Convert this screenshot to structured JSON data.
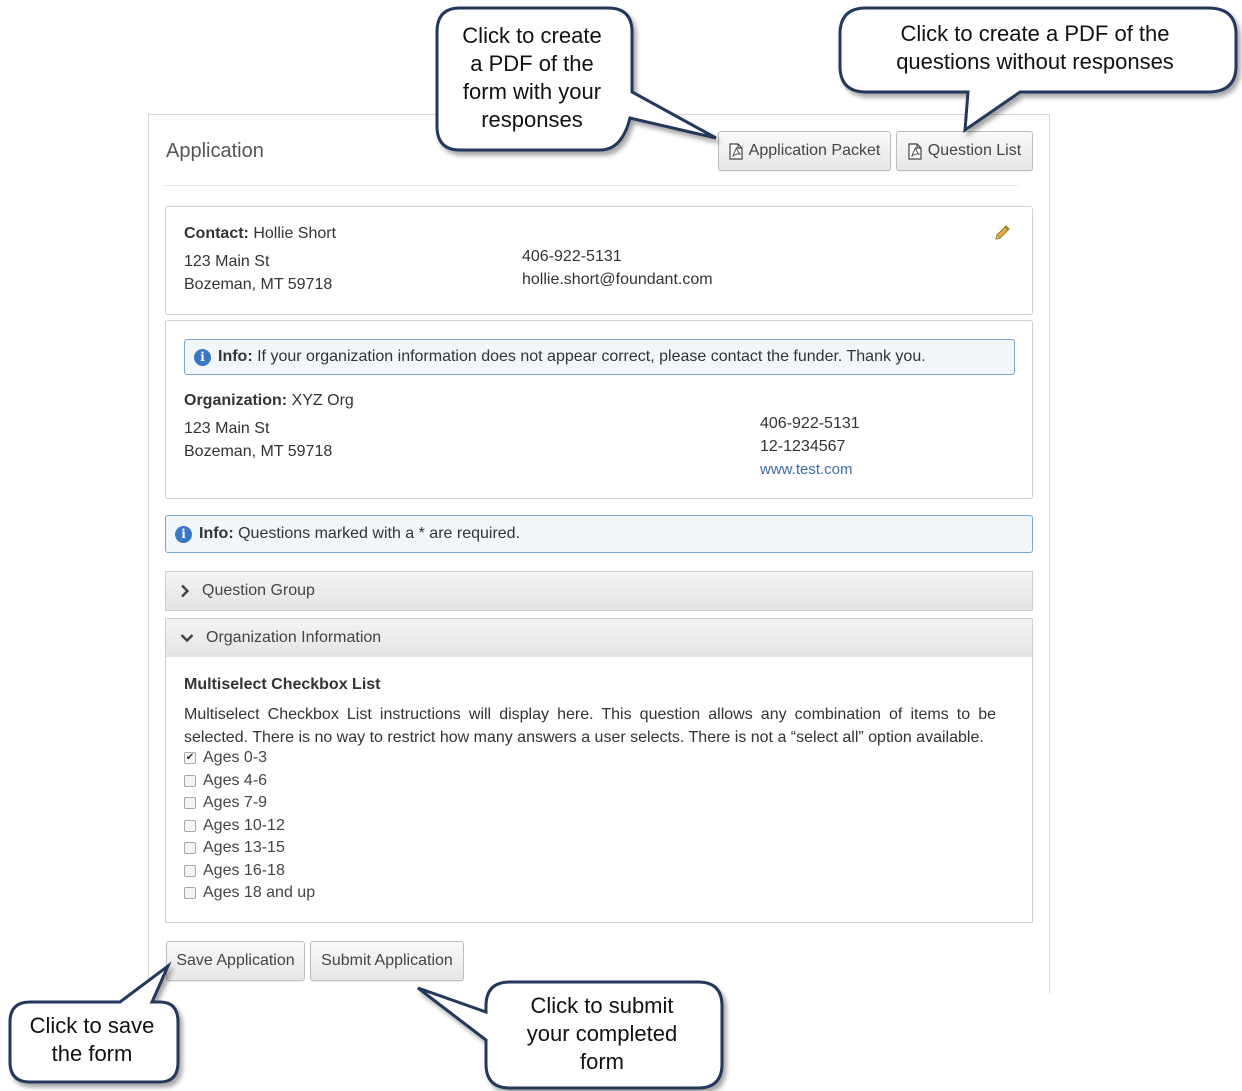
{
  "header": {
    "title": "Application",
    "application_packet_label": "Application Packet",
    "question_list_label": "Question List"
  },
  "contact": {
    "label": "Contact:",
    "name": "Hollie Short",
    "address1": "123 Main St",
    "address2": "Bozeman, MT 59718",
    "phone": "406-922-5131",
    "email": "hollie.short@foundant.com"
  },
  "org_info_alert": {
    "label": "Info:",
    "text": "If your organization information does not appear correct, please contact the funder. Thank you."
  },
  "organization": {
    "label": "Organization:",
    "name": "XYZ Org",
    "address1": "123 Main St",
    "address2": "Bozeman, MT 59718",
    "phone": "406-922-5131",
    "tax_id": "12-1234567",
    "website": "www.test.com"
  },
  "required_alert": {
    "label": "Info:",
    "text": "Questions marked with a * are required."
  },
  "accordion": {
    "question_group": "Question Group",
    "organization_information": "Organization Information"
  },
  "question": {
    "title": "Multiselect Checkbox List",
    "instructions": "Multiselect Checkbox List instructions will display here. This question allows any combination of items to be selected. There is no way to restrict how many answers a user selects. There is not a “select all” option available.",
    "options": [
      {
        "label": "Ages 0-3",
        "checked": true
      },
      {
        "label": "Ages 4-6",
        "checked": false
      },
      {
        "label": "Ages 7-9",
        "checked": false
      },
      {
        "label": "Ages 10-12",
        "checked": false
      },
      {
        "label": "Ages 13-15",
        "checked": false
      },
      {
        "label": "Ages 16-18",
        "checked": false
      },
      {
        "label": "Ages 18 and up",
        "checked": false
      }
    ]
  },
  "footer": {
    "save_label": "Save Application",
    "submit_label": "Submit Application"
  },
  "callouts": {
    "packet": [
      "Click to create",
      "a PDF of the",
      "form with your",
      "responses"
    ],
    "question_list": [
      "Click to create a PDF of the",
      "questions without responses"
    ],
    "save": [
      "Click to save",
      "the form"
    ],
    "submit": [
      "Click to submit",
      "your completed",
      "form"
    ]
  }
}
